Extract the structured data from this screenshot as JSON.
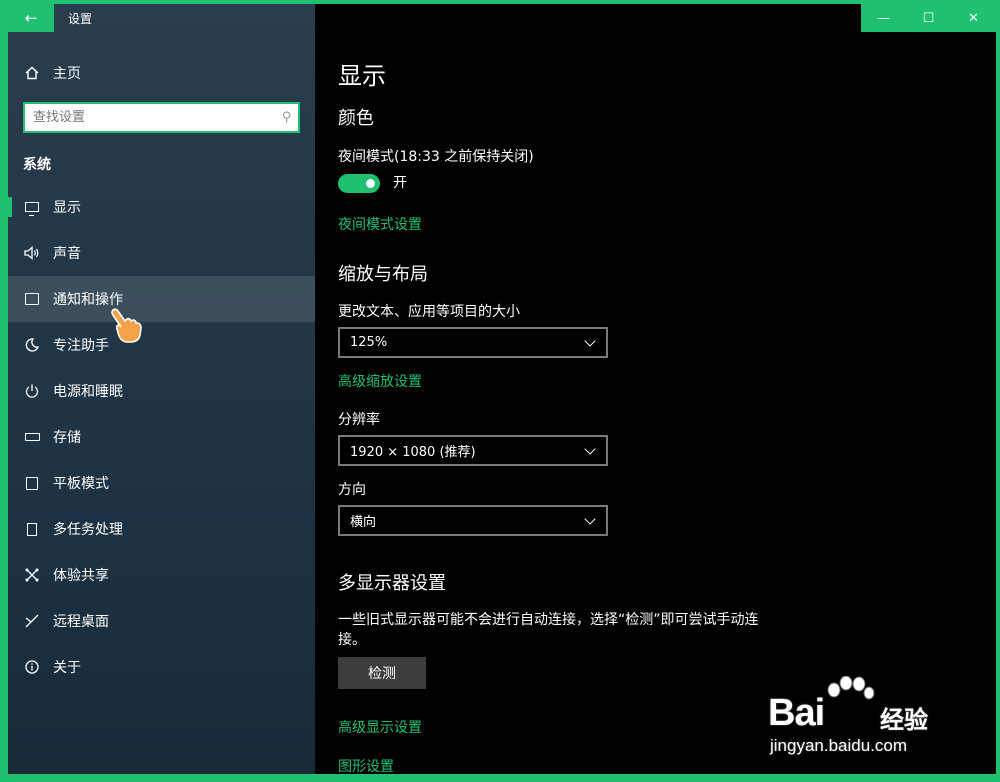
{
  "window": {
    "title": "设置",
    "back_icon": "arrow-left-icon",
    "controls": {
      "minimize": "—",
      "maximize": "☐",
      "close": "✕"
    }
  },
  "sidebar": {
    "home_label": "主页",
    "search": {
      "placeholder": "查找设置"
    },
    "section_label": "系统",
    "items": [
      {
        "label": "显示",
        "icon": "monitor-icon"
      },
      {
        "label": "声音",
        "icon": "speaker-icon"
      },
      {
        "label": "通知和操作",
        "icon": "notification-icon"
      },
      {
        "label": "专注助手",
        "icon": "moon-icon"
      },
      {
        "label": "电源和睡眠",
        "icon": "power-icon"
      },
      {
        "label": "存储",
        "icon": "storage-icon"
      },
      {
        "label": "平板模式",
        "icon": "tablet-icon"
      },
      {
        "label": "多任务处理",
        "icon": "multitask-icon"
      },
      {
        "label": "体验共享",
        "icon": "share-icon"
      },
      {
        "label": "远程桌面",
        "icon": "remote-desktop-icon"
      },
      {
        "label": "关于",
        "icon": "info-icon"
      }
    ]
  },
  "main": {
    "page_title": "显示",
    "color": {
      "heading": "颜色",
      "night_mode_label": "夜间模式(18:33 之前保持关闭)",
      "toggle_state": "开",
      "night_mode_settings_link": "夜间模式设置"
    },
    "scale_layout": {
      "heading": "缩放与布局",
      "text_size_label": "更改文本、应用等项目的大小",
      "text_size_value": "125%",
      "advanced_scaling_link": "高级缩放设置",
      "resolution_label": "分辨率",
      "resolution_value": "1920 × 1080 (推荐)",
      "orientation_label": "方向",
      "orientation_value": "横向"
    },
    "multi_display": {
      "heading": "多显示器设置",
      "description": "一些旧式显示器可能不会进行自动连接，选择“检测”即可尝试手动连接。",
      "detect_button": "检测",
      "advanced_display_link": "高级显示设置",
      "graphics_link": "图形设置"
    }
  },
  "watermark": {
    "brand": "Bai",
    "brand_suffix": "经验",
    "url": "jingyan.baidu.com"
  },
  "colors": {
    "accent": "#20c070",
    "sidebar_bg": "#223747",
    "content_bg": "#000000"
  }
}
